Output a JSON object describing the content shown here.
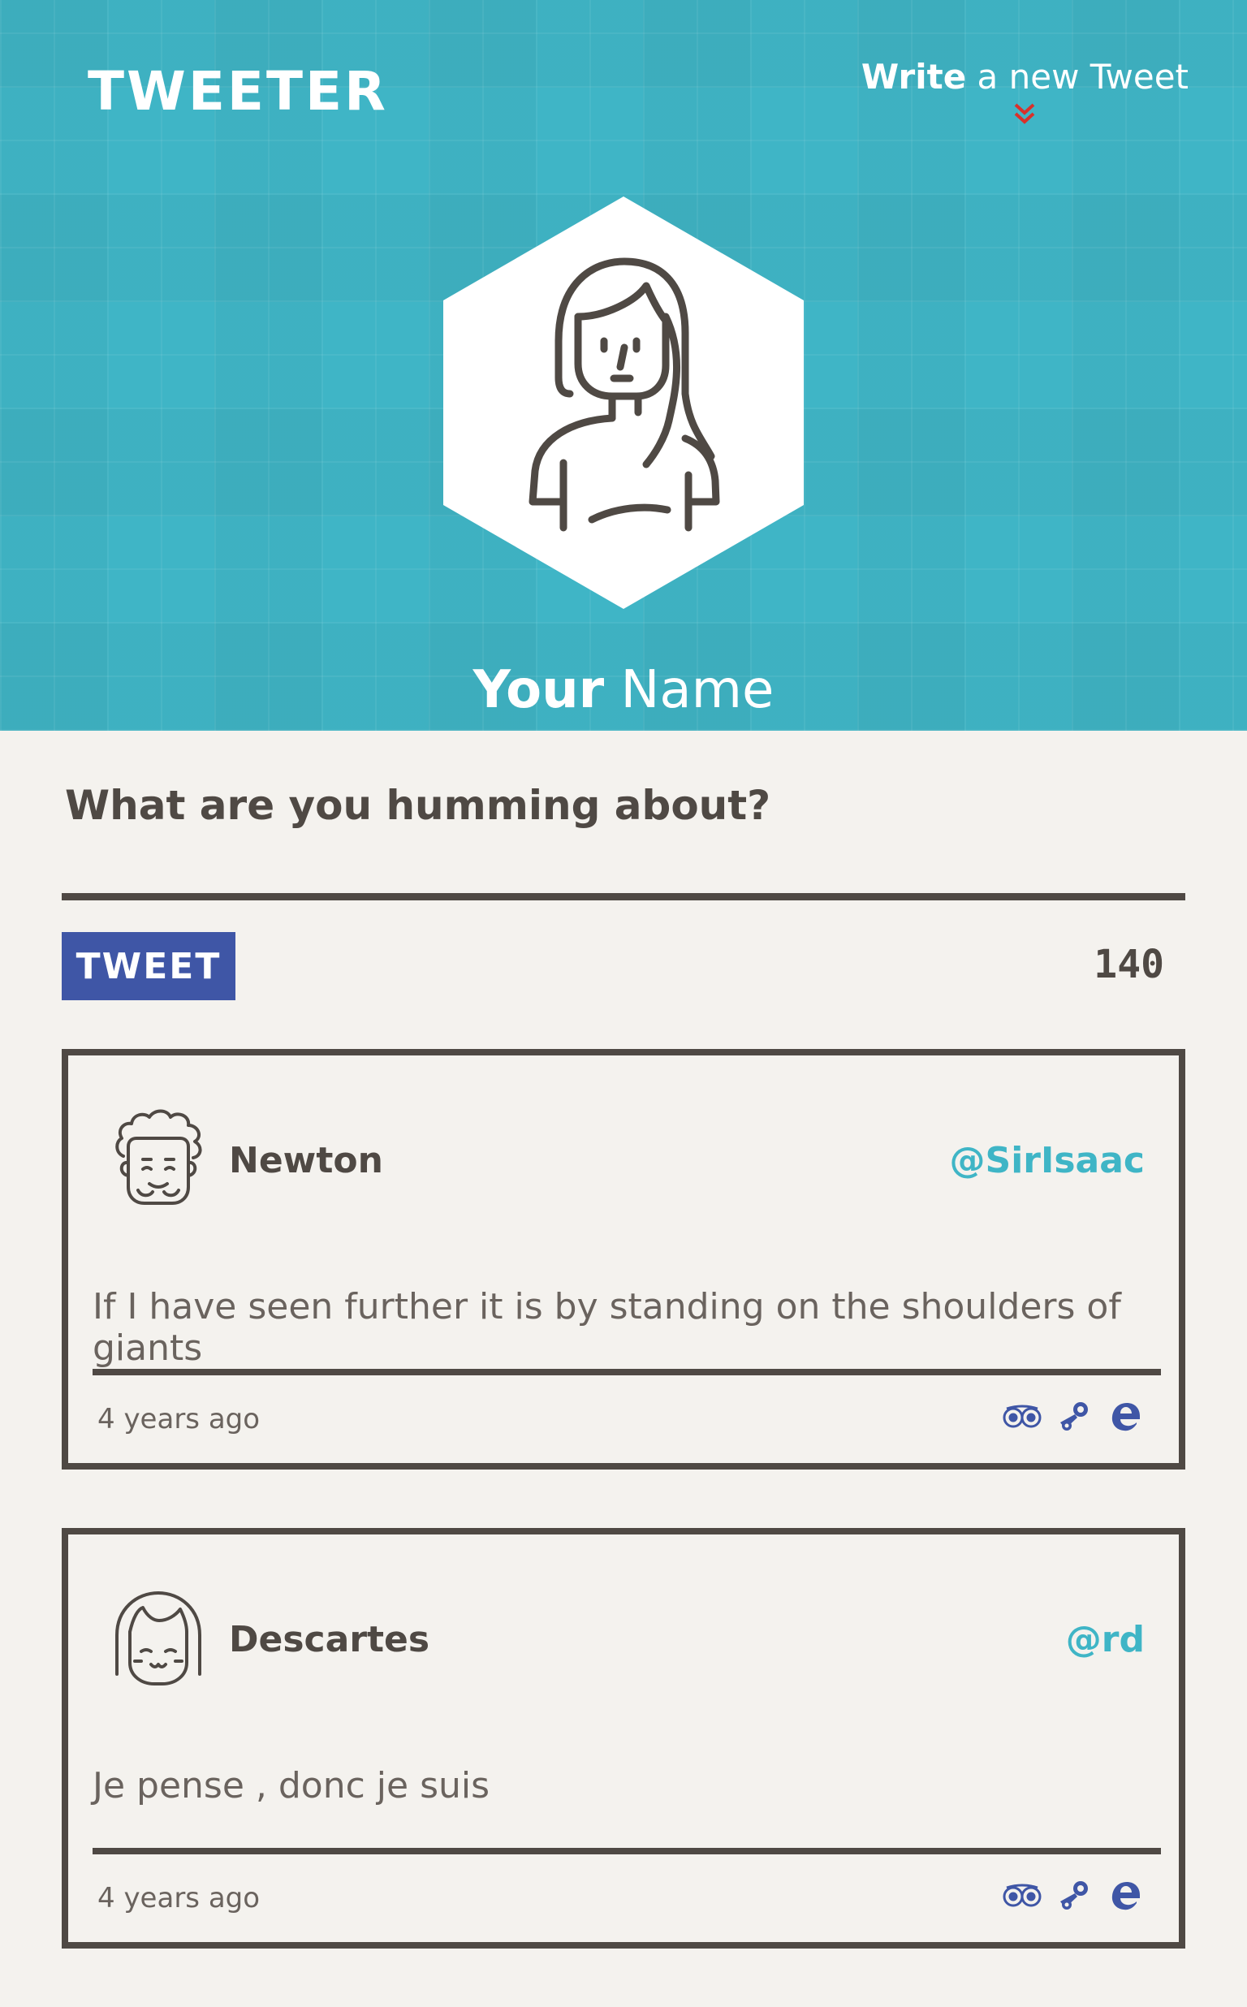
{
  "header": {
    "logo": "TWEETER",
    "write_strong": "Write",
    "write_light": "a new Tweet",
    "profile_first": "Your",
    "profile_last": "Name"
  },
  "composer": {
    "prompt": "What are you humming about?",
    "tweet_button": "TWEET",
    "counter": "140"
  },
  "tweets": [
    {
      "name": "Newton",
      "handle": "@SirIsaac",
      "content": "If I have seen further it is by standing on the shoulders of giants",
      "time": "4 years ago"
    },
    {
      "name": "Descartes",
      "handle": "@rd",
      "content": "Je pense , donc je suis",
      "time": "4 years ago"
    }
  ],
  "colors": {
    "header_bg": "#3fb5c6",
    "accent": "#3f56a6",
    "handle": "#3fb5c6",
    "text": "#4f4944",
    "page_bg": "#f4f2ee",
    "chevron": "#d9312b"
  },
  "icons": {
    "write_chevron": "double-chevron-down-icon",
    "action_1": "owl-icon",
    "action_2": "steam-icon",
    "action_3": "edge-icon"
  }
}
